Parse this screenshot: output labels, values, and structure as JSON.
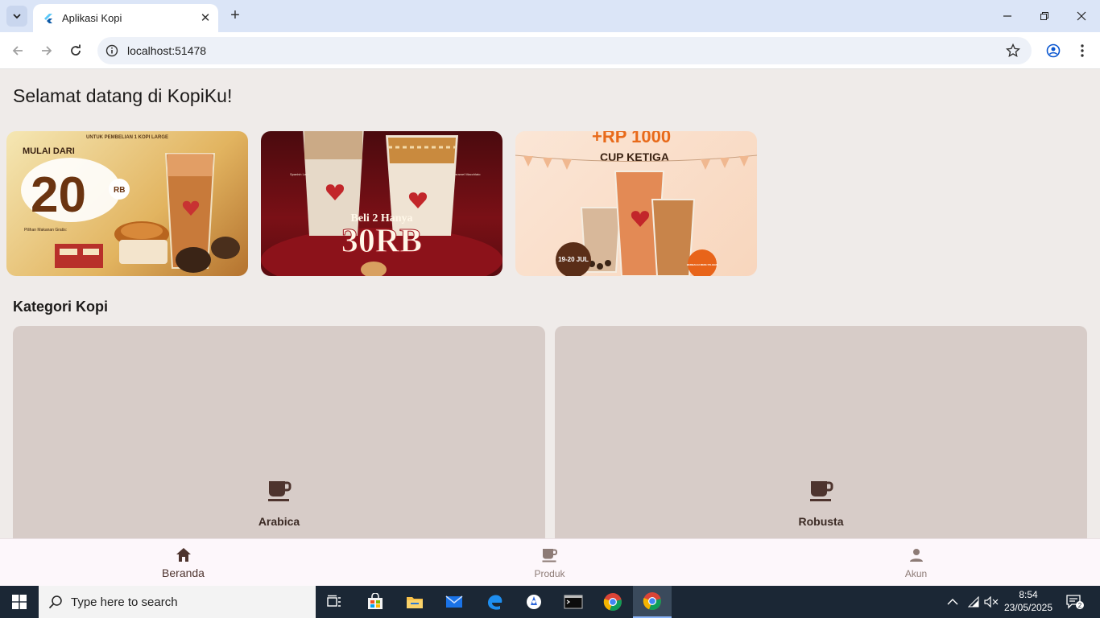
{
  "browser": {
    "tab_title": "Aplikasi Kopi",
    "url": "localhost:51478"
  },
  "app": {
    "welcome": "Selamat datang di KopiKu!",
    "banners": [
      {
        "top_text": "UNTUK PEMBELIAN 1 KOPI LARGE",
        "line1": "MULAI DARI",
        "big": "20",
        "suffix": "RB",
        "note": "Pilihan Makanan Gratis:"
      },
      {
        "line1": "Beli 2 Hanya",
        "big": "30RB",
        "left_label": "Spanish Latte",
        "right_label": "Caramel Macchiato"
      },
      {
        "top_text": "+RP 1000",
        "line1": "CUP KETIGA",
        "date": "19-20 JUL",
        "badge": "BERBAGAI MENU PILIHAN"
      }
    ],
    "category_title": "Kategori Kopi",
    "categories": [
      {
        "label": "Arabica",
        "icon": "coffee-cup-icon"
      },
      {
        "label": "Robusta",
        "icon": "coffee-cup-icon"
      }
    ],
    "colors": {
      "card": "#d7ccc8",
      "accent": "#4e342e",
      "background": "#efebe9"
    }
  },
  "bottom_nav": [
    {
      "label": "Beranda",
      "icon": "home-icon",
      "active": true
    },
    {
      "label": "Produk",
      "icon": "coffee-cup-icon",
      "active": false
    },
    {
      "label": "Akun",
      "icon": "person-icon",
      "active": false
    }
  ],
  "taskbar": {
    "search_placeholder": "Type here to search",
    "time": "8:54",
    "date": "23/05/2025",
    "notification_count": "2"
  }
}
